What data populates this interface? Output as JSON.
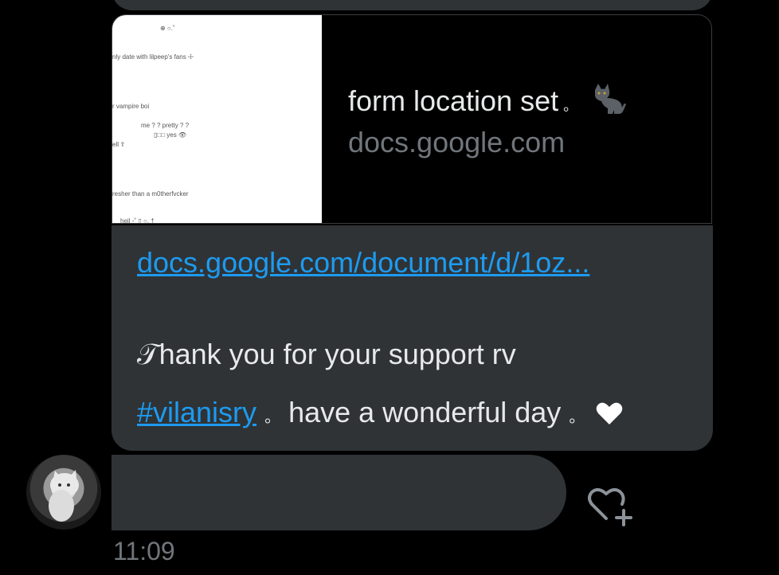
{
  "link_card": {
    "title": "form location set",
    "title_suffix": "。",
    "domain": "docs.google.com",
    "icon": "black-cat-icon",
    "thumbnail_lines": [
      "⊕ ○.˚",
      "nly date with lilpeep's fans ☩",
      "r vampire boi",
      "me ? ? pretty ? ?",
      "▯□□  yes 👁",
      "ell ☦",
      "resher than a m0therfvcker",
      "heil   ◦˚ ▯ ○. †"
    ]
  },
  "message": {
    "link_text": "docs.google.com/document/d/1oz...",
    "line1": "𝒯hank you for your support rv",
    "hashtag": "#vilanisry",
    "line2_rest": " have a wonderful day",
    "dot": "。",
    "heart_icon": "heart-icon"
  },
  "timestamp": "11:09",
  "colors": {
    "background": "#000000",
    "bubble": "#2f3336",
    "link": "#1d9bf0",
    "text": "#e7e9ea",
    "muted": "#71767b"
  }
}
